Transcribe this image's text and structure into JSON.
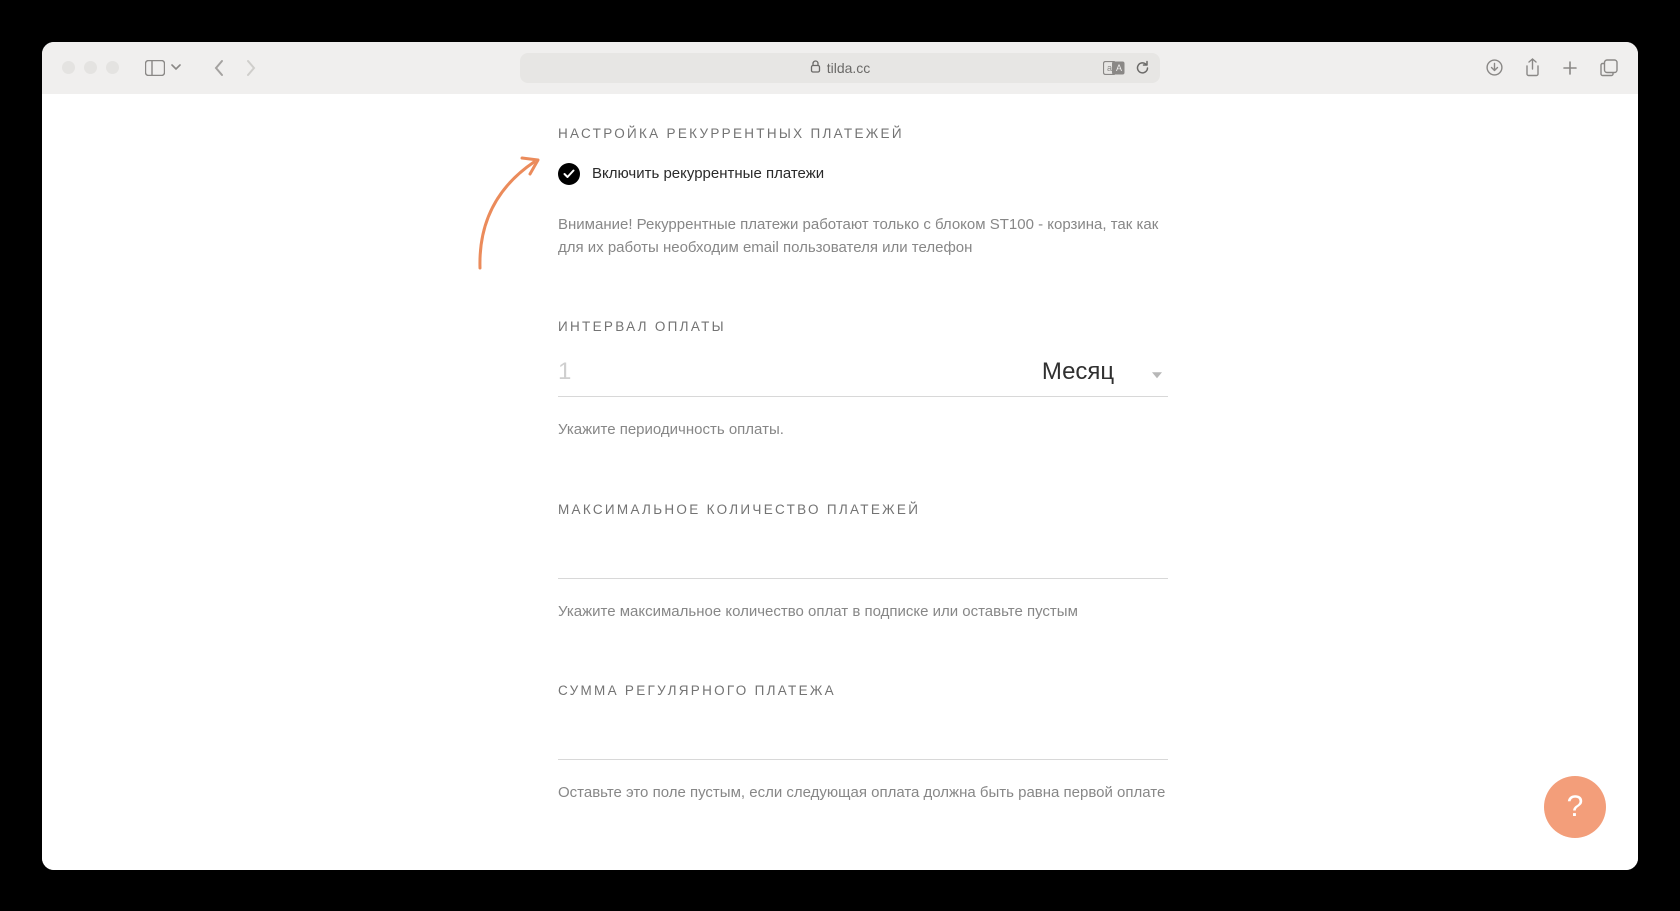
{
  "browser": {
    "url_host": "tilda.cc"
  },
  "section_recurring": {
    "title": "НАСТРОЙКА РЕКУРРЕНТНЫХ ПЛАТЕЖЕЙ",
    "checkbox_label": "Включить рекуррентные платежи",
    "checkbox_checked": true,
    "warning": "Внимание! Рекуррентные платежи работают только с блоком ST100 - корзина, так как для их работы необходим email пользователя или телефон"
  },
  "section_interval": {
    "title": "ИНТЕРВАЛ ОПЛАТЫ",
    "value_placeholder": "1",
    "unit_selected": "Месяц",
    "hint": "Укажите периодичность оплаты."
  },
  "section_max": {
    "title": "МАКСИМАЛЬНОЕ КОЛИЧЕСТВО ПЛАТЕЖЕЙ",
    "value": "",
    "hint": "Укажите максимальное количество оплат в подписке или оставьте пустым"
  },
  "section_amount": {
    "title": "СУММА РЕГУЛЯРНОГО ПЛАТЕЖА",
    "value": "",
    "hint": "Оставьте это поле пустым, если следующая оплата должна быть равна первой оплате"
  },
  "help_fab": {
    "label": "?"
  },
  "colors": {
    "accent_arrow": "#eb8b5b",
    "fab": "#f39e7a"
  }
}
